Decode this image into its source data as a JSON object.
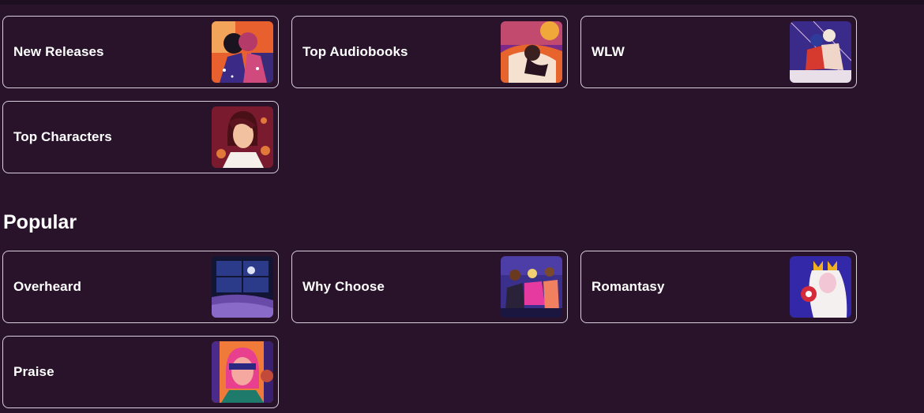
{
  "collections": [
    {
      "label": "New Releases",
      "icon": "new-releases-thumbnail"
    },
    {
      "label": "Top Audiobooks",
      "icon": "top-audiobooks-thumbnail"
    },
    {
      "label": "WLW",
      "icon": "wlw-thumbnail"
    },
    {
      "label": "Top Characters",
      "icon": "top-characters-thumbnail"
    }
  ],
  "popular": {
    "title": "Popular",
    "items": [
      {
        "label": "Overheard",
        "icon": "overheard-thumbnail"
      },
      {
        "label": "Why Choose",
        "icon": "why-choose-thumbnail"
      },
      {
        "label": "Romantasy",
        "icon": "romantasy-thumbnail"
      },
      {
        "label": "Praise",
        "icon": "praise-thumbnail"
      }
    ]
  },
  "colors": {
    "background": "#28132b",
    "card_border": "#d9cfdc",
    "text": "#ffffff"
  }
}
